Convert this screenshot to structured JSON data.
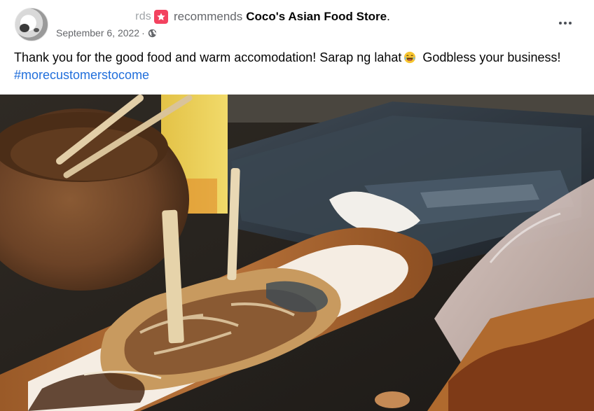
{
  "post": {
    "author": "rds",
    "verb": "recommends",
    "page_name": "Coco's Asian Food Store",
    "period": ".",
    "date": "September 6, 2022",
    "separator": "·",
    "audience_icon": "globe-icon",
    "recommend_icon": "star-badge-icon",
    "more_icon": "more-options-icon",
    "text_line_1": "Thank you for the good food and warm accomodation! Sarap ng lahat",
    "emoji_icon": "laughing-crying-emoji-icon",
    "text_after_emoji": " Godbless your business! ",
    "hashtag": "#morecustomerstocome"
  },
  "photo": {
    "subject": "takoyaki-photo"
  },
  "colors": {
    "recommend_badge": "#f3425f",
    "hashtag": "#216fdb",
    "secondary_text": "#65676b"
  }
}
